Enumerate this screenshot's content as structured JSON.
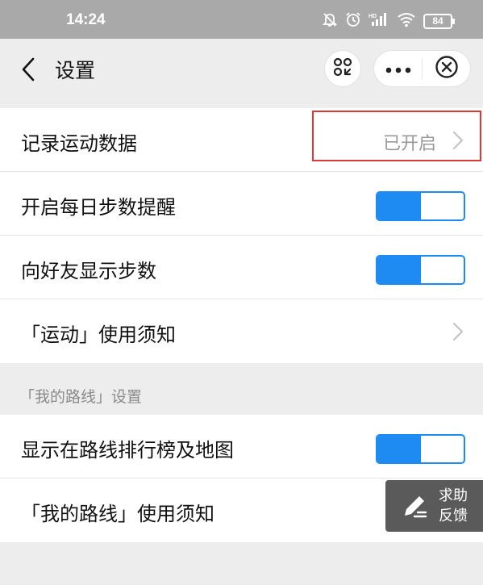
{
  "status_bar": {
    "time": "14:24",
    "battery": "84",
    "icons": [
      "mute-icon",
      "alarm-icon",
      "hd-signal-icon",
      "wifi-icon",
      "battery-icon"
    ]
  },
  "nav": {
    "title": "设置",
    "icons": [
      "back-icon",
      "scan-icon",
      "more-icon",
      "close-icon"
    ]
  },
  "group1": {
    "items": [
      {
        "label": "记录运动数据",
        "value": "已开启",
        "control": "chevron"
      },
      {
        "label": "开启每日步数提醒",
        "control": "toggle",
        "on": true
      },
      {
        "label": "向好友显示步数",
        "control": "toggle",
        "on": true
      },
      {
        "label": "「运动」使用须知",
        "control": "chevron"
      }
    ]
  },
  "section2": {
    "header": "「我的路线」设置",
    "items": [
      {
        "label": "显示在路线排行榜及地图",
        "control": "toggle",
        "on": true
      },
      {
        "label": "「我的路线」使用须知",
        "control": "chevron"
      }
    ]
  },
  "help_button": {
    "line1": "求助",
    "line2": "反馈"
  },
  "colors": {
    "accent": "#1d8bf1",
    "highlight": "#d83a3a",
    "status_bar": "#a9a9a9",
    "page_background": "#ededed"
  }
}
